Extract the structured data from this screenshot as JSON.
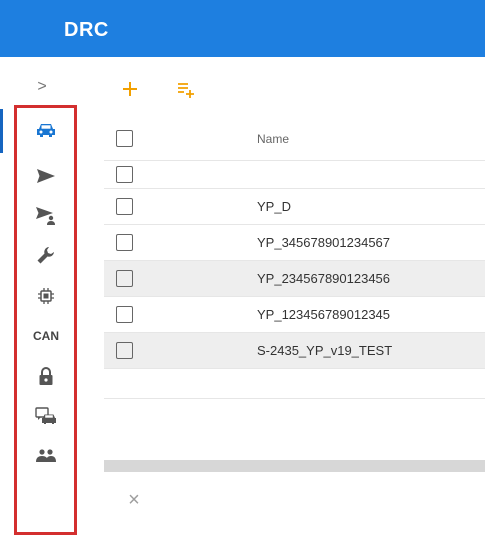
{
  "header": {
    "title": "DRC"
  },
  "sidebar": {
    "toggle_glyph": ">",
    "items": [
      {
        "icon": "car-icon",
        "active": true
      },
      {
        "icon": "send-icon"
      },
      {
        "icon": "send-person-icon"
      },
      {
        "icon": "wrench-icon"
      },
      {
        "icon": "chip-icon"
      },
      {
        "icon": "can-label",
        "label": "CAN"
      },
      {
        "icon": "lock-icon"
      },
      {
        "icon": "car-chat-icon"
      },
      {
        "icon": "people-icon"
      }
    ]
  },
  "toolbar": {
    "add_icon": "plus-icon",
    "add_to_list_icon": "playlist-add-icon",
    "accent_color": "#f2a000"
  },
  "table": {
    "columns": [
      "Name"
    ],
    "rows": [
      {
        "name": ""
      },
      {
        "name": "YP_D"
      },
      {
        "name": "YP_345678901234567"
      },
      {
        "name": "YP_234567890123456"
      },
      {
        "name": "YP_123456789012345"
      },
      {
        "name": "S-2435_YP_v19_TEST"
      }
    ]
  },
  "footer": {
    "close_glyph": "×"
  },
  "colors": {
    "header": "#1e7fe0",
    "active_icon": "#1976d2",
    "highlight_box": "#d32f2f"
  }
}
